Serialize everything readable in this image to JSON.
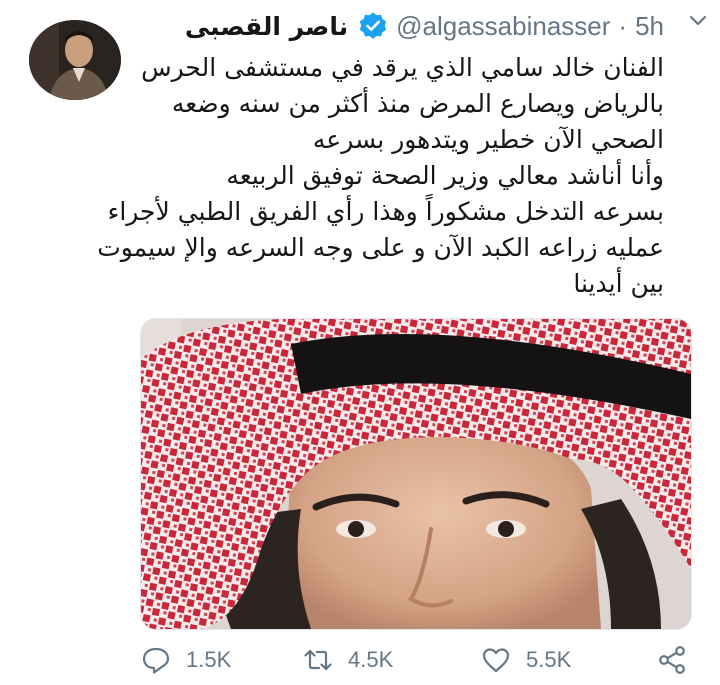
{
  "author": {
    "display_name": "ناصر القصبى",
    "handle": "@algassabinasser",
    "verified": true,
    "time": "5h",
    "separator": "·"
  },
  "tweet": {
    "lines": [
      "الفنان خالد سامي الذي يرقد في مستشفى الحرس",
      "بالرياض ويصارع المرض منذ أكثر من سنه وضعه",
      "الصحي الآن خطير ويتدهور بسرعه",
      "وأنا أناشد معالي وزير الصحة توفيق الربيعه",
      "بسرعه التدخل مشكوراً وهذا رأي الفريق الطبي لأجراء",
      "عمليه زراعه الكبد الآن و على وجه السرعه والإ سيموت",
      "بين أيدينا"
    ]
  },
  "actions": {
    "replies": "1.5K",
    "retweets": "4.5K",
    "likes": "5.5K"
  },
  "icons": {
    "more": "chevron-down-icon",
    "verified": "verified-badge-icon",
    "reply": "reply-icon",
    "retweet": "retweet-icon",
    "like": "heart-icon",
    "share": "share-icon"
  },
  "colors": {
    "verified_blue": "#1da1f2",
    "muted_text": "#657786",
    "text": "#14171a"
  }
}
